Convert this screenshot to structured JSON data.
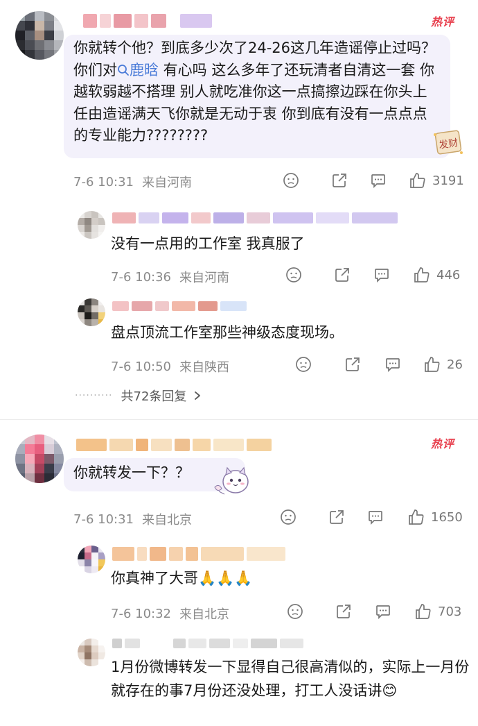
{
  "hot_label": "热评",
  "comments": [
    {
      "text_prefix": "你就转个他？到底多少次了24-26这几年造谣停止过吗？你们对",
      "topic": "鹿晗",
      "text_suffix": " 有心吗 这么多年了还玩清者自清这一套 你越软弱越不搭理 别人就吃准你这一点搞擦边踩在你头上 任由造谣满天飞你就是无动于衷 你到底有没有一点点点的专业能力????????",
      "time": "7-6 10:31",
      "location": "来自河南",
      "likes": "3191",
      "sticker_label": "发财"
    },
    {
      "text": "你就转发一下？？",
      "time": "7-6 10:31",
      "location": "来自北京",
      "likes": "1650"
    }
  ],
  "replies": [
    {
      "text": "没有一点用的工作室 我真服了",
      "time": "7-6 10:36",
      "location": "来自河南",
      "likes": "446"
    },
    {
      "text": "盘点顶流工作室那些神级态度现场。",
      "time": "7-6 10:50",
      "location": "来自陕西",
      "likes": "26"
    },
    {
      "text": "你真神了大哥🙏🙏🙏",
      "time": "7-6 10:32",
      "location": "来自北京",
      "likes": "703"
    },
    {
      "text": "1月份微博转发一下显得自己很高清似的，实际上一月份就存在的事7月份还没处理，打工人没话讲😊"
    }
  ],
  "more_replies_label": "共72条回复",
  "colors": {
    "hot": "#e8414f",
    "topic": "#4a7bd8",
    "bubble": "#f3f1fb",
    "meta": "#8a8a8a"
  },
  "icons": [
    "dislike-icon",
    "share-icon",
    "comment-icon",
    "like-icon",
    "search-icon",
    "chevron-right-icon"
  ]
}
